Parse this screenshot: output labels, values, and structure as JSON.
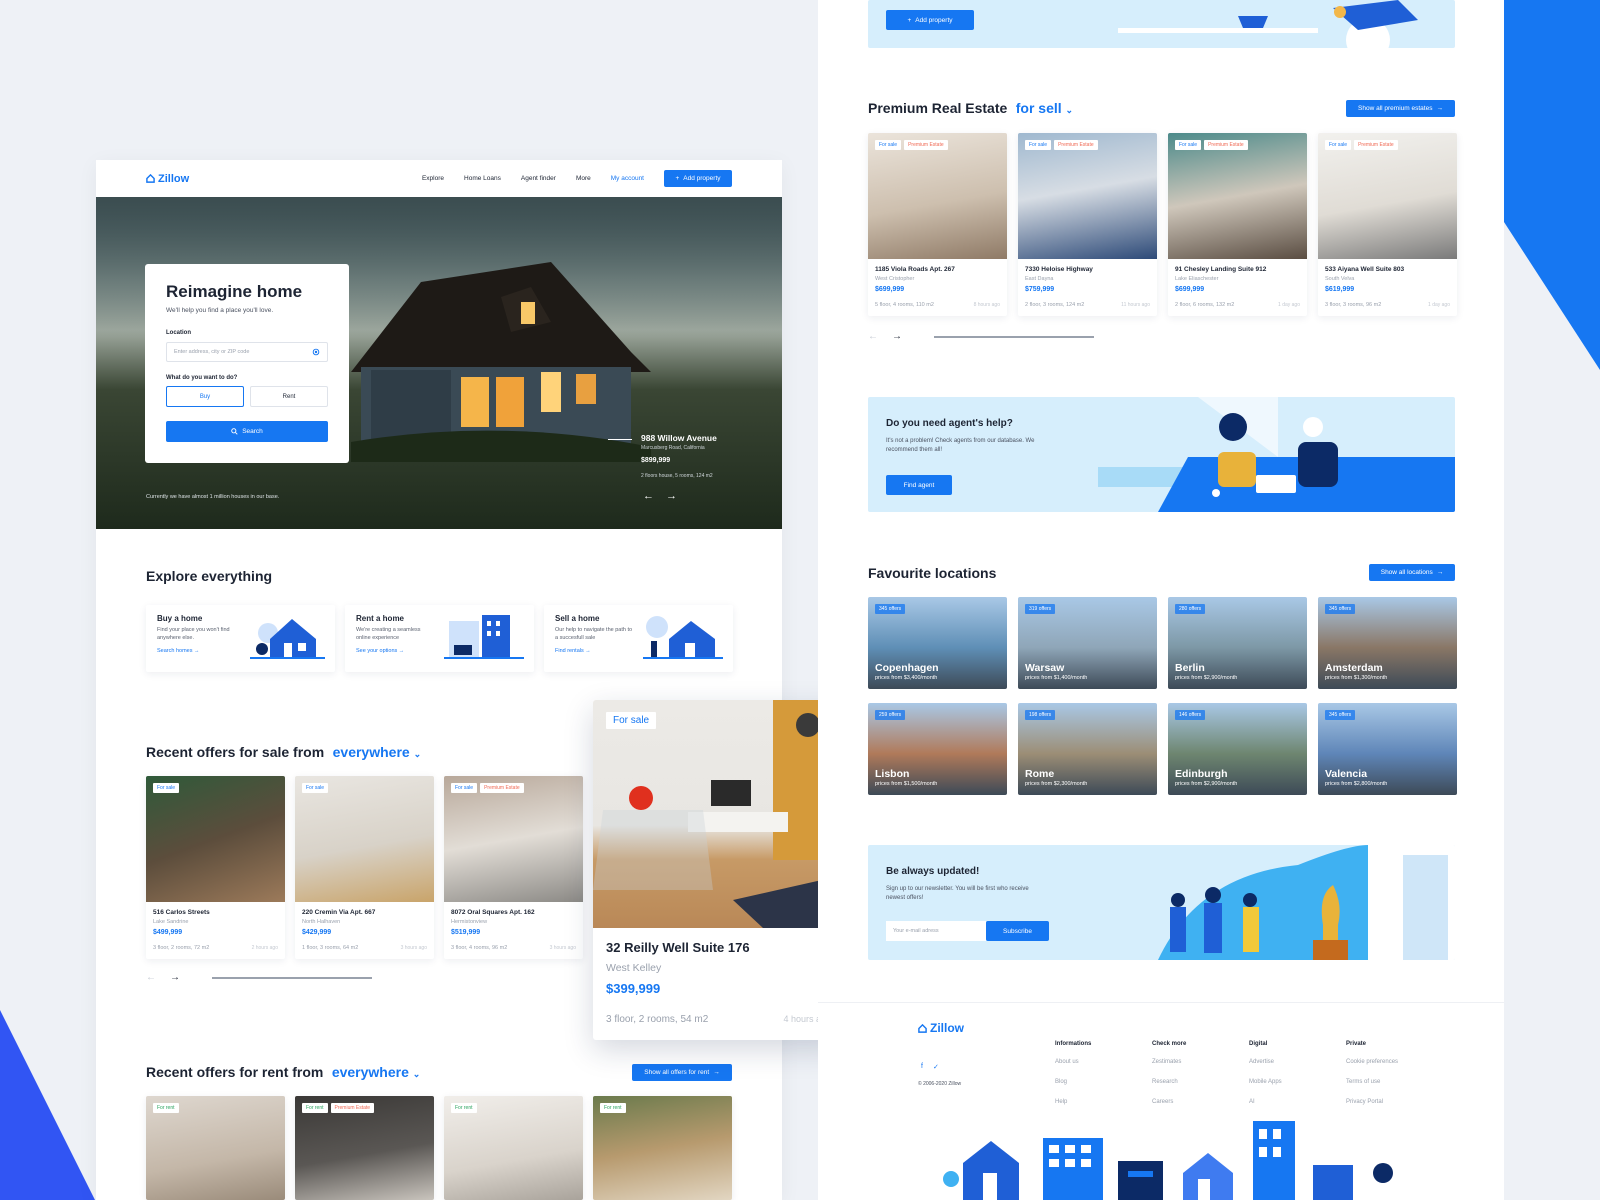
{
  "brand": {
    "name": "Zillow",
    "accent": "#1677f2",
    "copyright": "© 2006-2020 Zillow"
  },
  "nav": {
    "items": [
      "Explore",
      "Home Loans",
      "Agent finder",
      "More"
    ],
    "account": "My account",
    "cta": "Add property"
  },
  "hero": {
    "title": "Reimagine home",
    "subtitle": "We'll help you find a place you'll love.",
    "location_label": "Location",
    "location_placeholder": "Enter address, city or ZIP code",
    "question": "What do you want to do?",
    "options": [
      "Buy",
      "Rent"
    ],
    "selected_option": "Buy",
    "search_label": "Search",
    "footnote": "Currently we have almost 1 million houses in our base.",
    "featured": {
      "name": "988 Willow Avenue",
      "location": "Marcusberg Road, California",
      "price": "$899,999",
      "details": "2 floors house, 5 rooms, 124 m2"
    }
  },
  "explore": {
    "title": "Explore everything",
    "cards": [
      {
        "title": "Buy a home",
        "desc": "Find your place you won't find anywhere else.",
        "link": "Search homes"
      },
      {
        "title": "Rent a home",
        "desc": "We're creating a seamless online experience",
        "link": "See your options"
      },
      {
        "title": "Sell a home",
        "desc": "Our help to navigate the path to a succesfull sale",
        "link": "Find rentals"
      }
    ]
  },
  "recent_sale": {
    "title": "Recent offers for sale from",
    "filter": "everywhere",
    "items": [
      {
        "tags": [
          "For sale"
        ],
        "name": "516 Carlos Streets",
        "city": "Lake Sandrine",
        "price": "$499,999",
        "meta": "3 floor, 2 rooms, 72 m2",
        "time": "2 hours ago"
      },
      {
        "tags": [
          "For sale"
        ],
        "name": "220 Cremin Via Apt. 667",
        "city": "North Halhaven",
        "price": "$429,999",
        "meta": "1 floor, 3 rooms, 64 m2",
        "time": "3 hours ago"
      },
      {
        "tags": [
          "For sale",
          "Premium Estate"
        ],
        "name": "8072 Oral Squares Apt. 162",
        "city": "Hermistonview",
        "price": "$519,999",
        "meta": "3 floor, 4 rooms, 96 m2",
        "time": "3 hours ago"
      }
    ]
  },
  "featured_card": {
    "tag": "For sale",
    "name": "32 Reilly Well Suite 176",
    "city": "West Kelley",
    "price": "$399,999",
    "meta": "3 floor, 2 rooms, 54 m2",
    "time": "4 hours ago"
  },
  "recent_rent": {
    "title": "Recent offers for rent from",
    "filter": "everywhere",
    "cta": "Show all offers for rent",
    "items": [
      {
        "tags": [
          "For rent"
        ]
      },
      {
        "tags": [
          "For rent",
          "Premium Estate"
        ]
      },
      {
        "tags": [
          "For rent"
        ]
      },
      {
        "tags": [
          "For rent"
        ]
      }
    ]
  },
  "top_banner": {
    "cta": "Add property"
  },
  "premium": {
    "title": "Premium Real Estate",
    "filter": "for sell",
    "cta": "Show all premium estates",
    "items": [
      {
        "tags": [
          "For sale",
          "Premium Estate"
        ],
        "name": "1185 Viola Roads Apt. 267",
        "city": "West Cristopher",
        "price": "$699,999",
        "meta": "5 floor, 4 rooms, 110 m2",
        "time": "8 hours ago"
      },
      {
        "tags": [
          "For sale",
          "Premium Estate"
        ],
        "name": "7330 Heloise Highway",
        "city": "East Dayna",
        "price": "$759,999",
        "meta": "2 floor, 3 rooms, 124 m2",
        "time": "11 hours ago"
      },
      {
        "tags": [
          "For sale",
          "Premium Estate"
        ],
        "name": "91 Chesley Landing Suite 912",
        "city": "Lake Eliaschester",
        "price": "$699,999",
        "meta": "2 floor, 6 rooms, 132 m2",
        "time": "1 day ago"
      },
      {
        "tags": [
          "For sale",
          "Premium Estate"
        ],
        "name": "533 Aiyana Well Suite 803",
        "city": "South Velva",
        "price": "$619,999",
        "meta": "3 floor, 3 rooms, 96 m2",
        "time": "1 day ago"
      }
    ]
  },
  "agent": {
    "title": "Do you need agent's help?",
    "desc": "It's not a problem! Check agents from our database. We recommend them all!",
    "cta": "Find agent"
  },
  "locations": {
    "title": "Favourite locations",
    "cta": "Show all locations",
    "items": [
      {
        "offers": "345 offers",
        "name": "Copenhagen",
        "price": "prices from $3,400/month",
        "color": "#5f8fb6"
      },
      {
        "offers": "319 offers",
        "name": "Warsaw",
        "price": "prices from $1,400/month",
        "color": "#8fa6b8"
      },
      {
        "offers": "280 offers",
        "name": "Berlin",
        "price": "prices from $2,900/month",
        "color": "#7d98a6"
      },
      {
        "offers": "345 offers",
        "name": "Amsterdam",
        "price": "prices from $1,300/month",
        "color": "#8a7766"
      },
      {
        "offers": "259 offers",
        "name": "Lisbon",
        "price": "prices from $1,500/month",
        "color": "#b07a5a"
      },
      {
        "offers": "198 offers",
        "name": "Rome",
        "price": "prices from $2,300/month",
        "color": "#9c8e76"
      },
      {
        "offers": "146 offers",
        "name": "Edinburgh",
        "price": "prices from $2,900/month",
        "color": "#6e8670"
      },
      {
        "offers": "345 offers",
        "name": "Valencia",
        "price": "prices from $2,800/month",
        "color": "#5f86b8"
      }
    ]
  },
  "newsletter": {
    "title": "Be always updated!",
    "desc": "Sign up to our newsletter. You will be first who receive newest offers!",
    "placeholder": "Your e-mail adress",
    "cta": "Subscribe"
  },
  "footer": {
    "columns": [
      {
        "title": "Informations",
        "links": [
          "About us",
          "Blog",
          "Help"
        ]
      },
      {
        "title": "Check more",
        "links": [
          "Zestimates",
          "Research",
          "Careers"
        ]
      },
      {
        "title": "Digital",
        "links": [
          "Advertise",
          "Mobile Apps",
          "AI"
        ]
      },
      {
        "title": "Private",
        "links": [
          "Cookie preferences",
          "Terms of use",
          "Privacy Portal"
        ]
      }
    ],
    "social": [
      "facebook-icon",
      "twitter-icon"
    ]
  }
}
